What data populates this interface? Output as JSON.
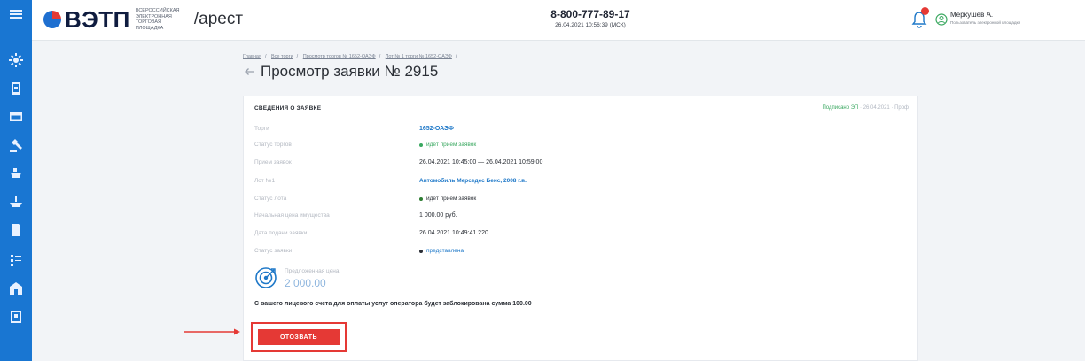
{
  "header": {
    "logo_text": "ВЭТП",
    "logo_subtitle": "Всероссийская электронная торговая площадка",
    "section": "/арест",
    "phone": "8-800-777-89-17",
    "datetime": "26.04.2021 10:56:39 (МСК)",
    "user_name": "Меркушев А.",
    "user_role": "Пользователь электронной площадки"
  },
  "breadcrumb": [
    "Главная",
    "Все торги",
    "Просмотр торгов № 1652-ОАЭФ",
    "Лот № 1 торги № 1652-ОАЭФ"
  ],
  "page_title": "Просмотр заявки № 2915",
  "card": {
    "title": "СВЕДЕНИЯ О ЗАЯВКЕ",
    "signed_label": "Подписано ЭП",
    "signed_meta": "· 26.04.2021 · Проф",
    "rows": [
      {
        "label": "Торги",
        "value": "1652-ОАЭФ"
      },
      {
        "label": "Статус торгов",
        "value": "идет прием заявок"
      },
      {
        "label": "Прием заявок",
        "value": "26.04.2021 10:45:00 — 26.04.2021 10:59:00"
      },
      {
        "label": "Лот №1",
        "value": "Автомобиль Мерседес Бенс, 2008 г.в."
      },
      {
        "label": "Статус лота",
        "value": "идет прием заявок"
      },
      {
        "label": "Начальная цена имущества",
        "value": "1 000.00 руб."
      },
      {
        "label": "Дата подачи заявки",
        "value": "26.04.2021 10:49:41.220"
      },
      {
        "label": "Статус заявки",
        "value": "представлена"
      }
    ],
    "price_label": "Предложенная цена",
    "price_value": "2 000.00",
    "notice": "С вашего лицевого счета для оплаты услуг оператора будет заблокирована сумма 100.00",
    "withdraw_label": "ОТОЗВАТЬ"
  },
  "colors": {
    "sidebar": "#1976d2",
    "link": "#1e78c8",
    "status_green": "#3aa860",
    "danger": "#e53935"
  },
  "icons": {
    "sidebar": [
      "menu-icon",
      "gear-icon",
      "tablet-icon",
      "card-icon",
      "gavel-icon",
      "ship-icon",
      "boat-icon",
      "document-icon",
      "list-icon",
      "building-icon",
      "badge-icon"
    ]
  }
}
